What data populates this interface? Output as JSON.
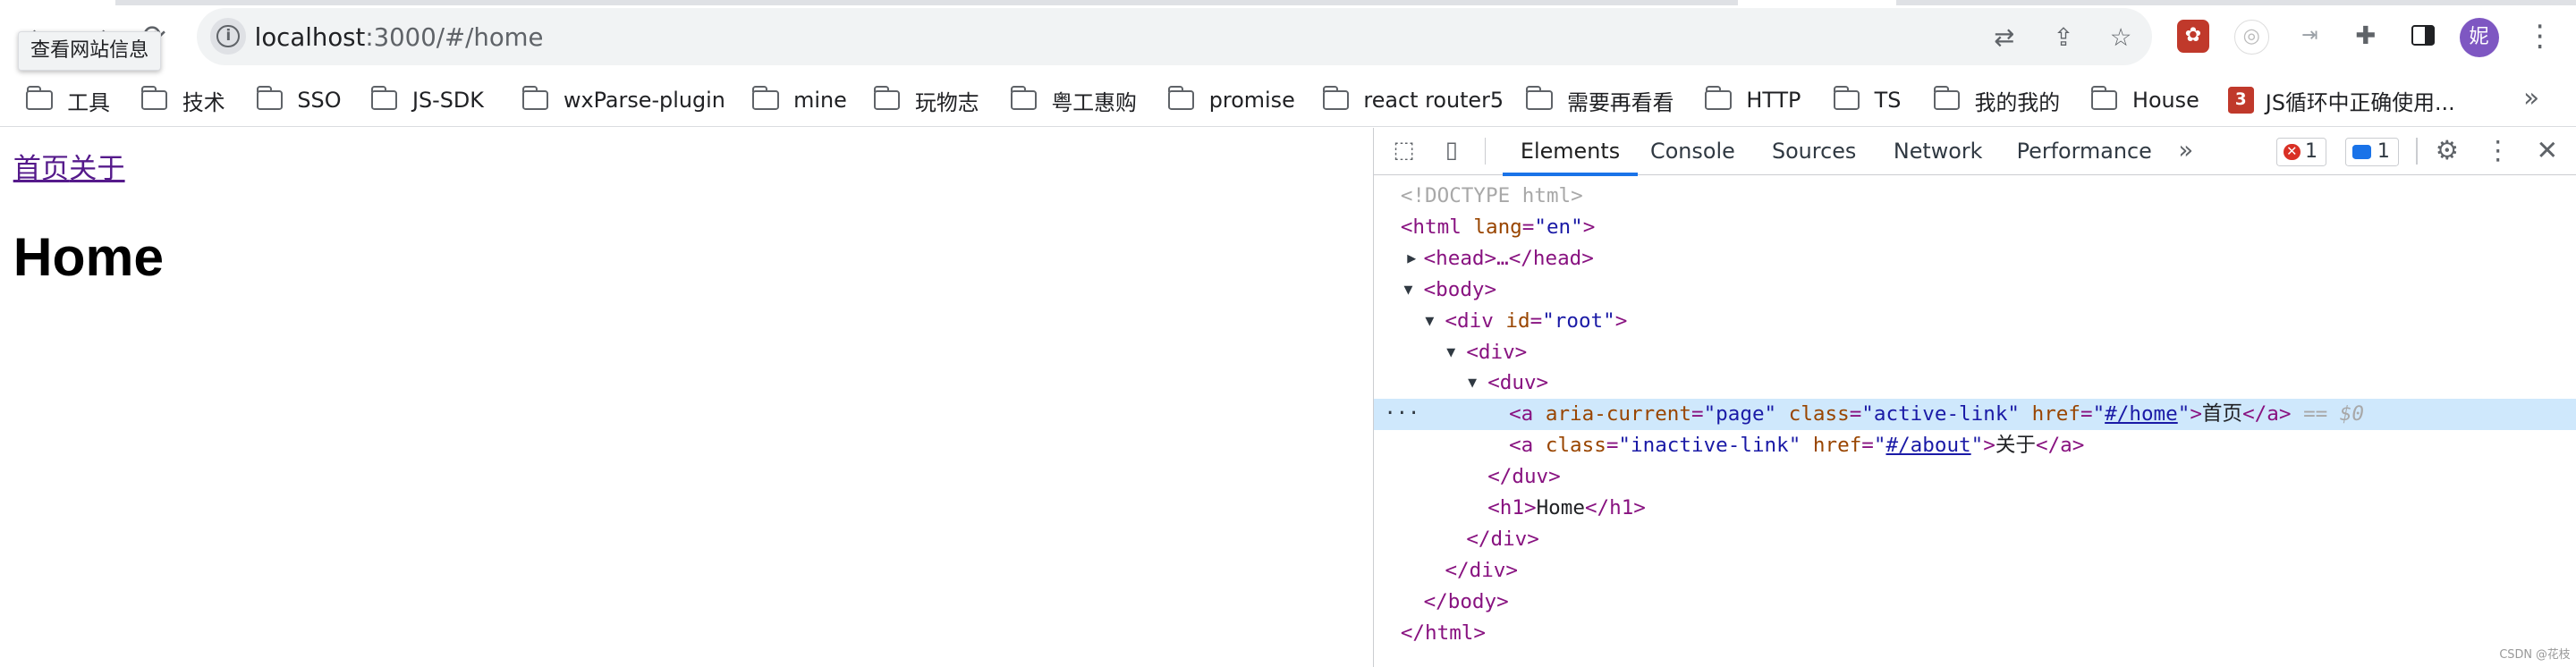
{
  "browser": {
    "tooltip": "查看网站信息",
    "url_host": "localhost",
    "url_path": ":3000/#/home",
    "profile_initial": "妮"
  },
  "bookmarks": [
    {
      "label": "工具",
      "icon": "folder-icon"
    },
    {
      "label": "技术",
      "icon": "folder-icon"
    },
    {
      "label": "SSO",
      "icon": "folder-icon"
    },
    {
      "label": "JS-SDK",
      "icon": "folder-icon"
    },
    {
      "label": "wxParse-plugin",
      "icon": "folder-icon"
    },
    {
      "label": "mine",
      "icon": "folder-icon"
    },
    {
      "label": "玩物志",
      "icon": "folder-icon"
    },
    {
      "label": "粤工惠购",
      "icon": "folder-icon"
    },
    {
      "label": "promise",
      "icon": "folder-icon"
    },
    {
      "label": "react router5",
      "icon": "folder-icon"
    },
    {
      "label": "需要再看看",
      "icon": "folder-icon"
    },
    {
      "label": "HTTP",
      "icon": "folder-icon"
    },
    {
      "label": "TS",
      "icon": "folder-icon"
    },
    {
      "label": "我的我的",
      "icon": "folder-icon"
    },
    {
      "label": "House",
      "icon": "folder-icon"
    },
    {
      "label": "JS循环中正确使用...",
      "icon": "js-favicon-icon"
    }
  ],
  "page": {
    "link_home": "首页",
    "link_about": "关于",
    "heading": "Home"
  },
  "devtools": {
    "tabs": [
      "Elements",
      "Console",
      "Sources",
      "Network",
      "Performance"
    ],
    "active_tab": "Elements",
    "error_count": "1",
    "message_count": "1",
    "dom": {
      "doctype": "<!DOCTYPE html>",
      "html_open": "<html",
      "lang_attr": "lang",
      "lang_val": "\"en\"",
      "head": "<head>…</head>",
      "body_open": "<body>",
      "div_root_open": "<div",
      "id_attr": "id",
      "id_val": "\"root\"",
      "div_open": "<div>",
      "duv_open": "<duv>",
      "a1_open": "<a",
      "aria_attr": "aria-current",
      "aria_val": "\"page\"",
      "class_attr": "class",
      "class_active_val": "\"active-link\"",
      "href_attr": "href",
      "href1": "#/home",
      "a1_text": "首页",
      "a_close": "</a>",
      "eq_marker": "== $0",
      "class_inactive_val": "\"inactive-link\"",
      "href2": "#/about",
      "a2_text": "关于",
      "duv_close": "</duv>",
      "h1_open": "<h1>",
      "h1_text": "Home",
      "h1_close": "</h1>",
      "div_close": "</div>",
      "body_close": "</body>",
      "html_close": "</html>"
    }
  },
  "watermark": "CSDN @花枝"
}
